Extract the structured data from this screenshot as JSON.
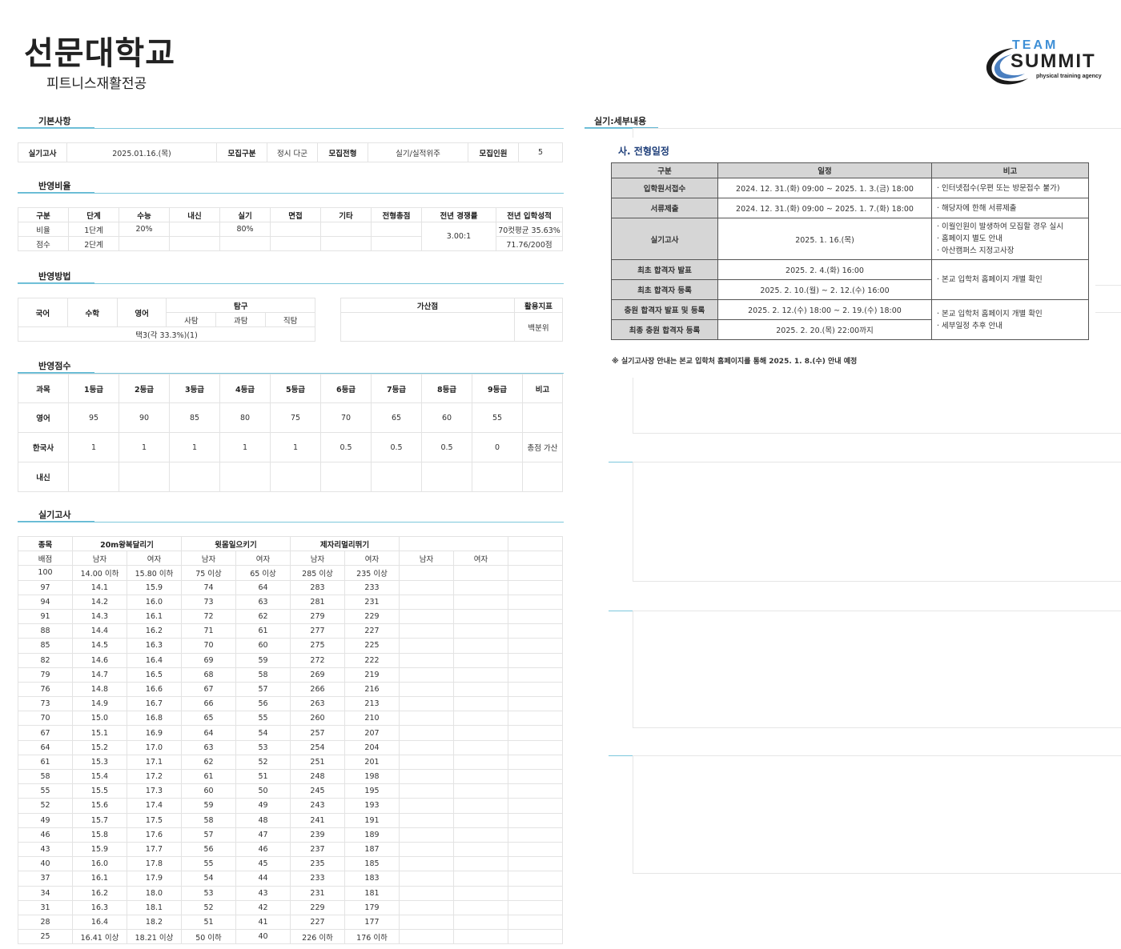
{
  "header": {
    "university": "선문대학교",
    "department": "피트니스재활전공"
  },
  "logo": {
    "line1": "TEAM",
    "line2": "SUMMIT",
    "tagline": "physical training agency",
    "icon": "swoosh-icon"
  },
  "sections": {
    "basic": "기본사항",
    "ratio": "반영비율",
    "method": "반영방법",
    "score": "반영점수",
    "practical": "실기고사",
    "detail": "실기:세부내용"
  },
  "basic": {
    "exam_label": "실기고사",
    "exam_value": "2025.01.16.(목)",
    "type_label": "모집구분",
    "type_value": "정시 다군",
    "track_label": "모집전형",
    "track_value": "실기/실적위주",
    "count_label": "모집인원",
    "count_value": "5"
  },
  "ratio": {
    "headers": [
      "구분",
      "단계",
      "수능",
      "내신",
      "실기",
      "면접",
      "기타",
      "전형총점",
      "전년 경쟁률",
      "전년 입학성적"
    ],
    "row1": [
      "비율",
      "1단계",
      "20%",
      "",
      "80%",
      "",
      "",
      ""
    ],
    "row2": [
      "점수",
      "2단계",
      "",
      "",
      "",
      "",
      "",
      ""
    ],
    "competition": "3.00:1",
    "prev1": "70컷평균 35.63%",
    "prev2": "71.76/200점"
  },
  "method": {
    "kor": "국어",
    "math": "수학",
    "eng": "영어",
    "inquiry": "탐구",
    "sub": [
      "사탐",
      "과탐",
      "직탐"
    ],
    "choice": "택3(각 33.3%)(1)",
    "bonus": "가산점",
    "index": "활용지표",
    "index_value": "백분위"
  },
  "score": {
    "headers": [
      "과목",
      "1등급",
      "2등급",
      "3등급",
      "4등급",
      "5등급",
      "6등급",
      "7등급",
      "8등급",
      "9등급",
      "비고"
    ],
    "rows": [
      [
        "영어",
        "95",
        "90",
        "85",
        "80",
        "75",
        "70",
        "65",
        "60",
        "55",
        ""
      ],
      [
        "한국사",
        "1",
        "1",
        "1",
        "1",
        "1",
        "0.5",
        "0.5",
        "0.5",
        "0",
        "총점 가산"
      ],
      [
        "내신",
        "",
        "",
        "",
        "",
        "",
        "",
        "",
        "",
        "",
        ""
      ]
    ]
  },
  "practical": {
    "col_event": "종목",
    "col_score": "배점",
    "events": [
      "20m왕복달리기",
      "윗몸일으키기",
      "제자리멀리뛰기"
    ],
    "male": "남자",
    "female": "여자",
    "rows": [
      [
        "100",
        "14.00 이하",
        "15.80 이하",
        "75 이상",
        "65 이상",
        "285 이상",
        "235 이상"
      ],
      [
        "97",
        "14.1",
        "15.9",
        "74",
        "64",
        "283",
        "233"
      ],
      [
        "94",
        "14.2",
        "16.0",
        "73",
        "63",
        "281",
        "231"
      ],
      [
        "91",
        "14.3",
        "16.1",
        "72",
        "62",
        "279",
        "229"
      ],
      [
        "88",
        "14.4",
        "16.2",
        "71",
        "61",
        "277",
        "227"
      ],
      [
        "85",
        "14.5",
        "16.3",
        "70",
        "60",
        "275",
        "225"
      ],
      [
        "82",
        "14.6",
        "16.4",
        "69",
        "59",
        "272",
        "222"
      ],
      [
        "79",
        "14.7",
        "16.5",
        "68",
        "58",
        "269",
        "219"
      ],
      [
        "76",
        "14.8",
        "16.6",
        "67",
        "57",
        "266",
        "216"
      ],
      [
        "73",
        "14.9",
        "16.7",
        "66",
        "56",
        "263",
        "213"
      ],
      [
        "70",
        "15.0",
        "16.8",
        "65",
        "55",
        "260",
        "210"
      ],
      [
        "67",
        "15.1",
        "16.9",
        "64",
        "54",
        "257",
        "207"
      ],
      [
        "64",
        "15.2",
        "17.0",
        "63",
        "53",
        "254",
        "204"
      ],
      [
        "61",
        "15.3",
        "17.1",
        "62",
        "52",
        "251",
        "201"
      ],
      [
        "58",
        "15.4",
        "17.2",
        "61",
        "51",
        "248",
        "198"
      ],
      [
        "55",
        "15.5",
        "17.3",
        "60",
        "50",
        "245",
        "195"
      ],
      [
        "52",
        "15.6",
        "17.4",
        "59",
        "49",
        "243",
        "193"
      ],
      [
        "49",
        "15.7",
        "17.5",
        "58",
        "48",
        "241",
        "191"
      ],
      [
        "46",
        "15.8",
        "17.6",
        "57",
        "47",
        "239",
        "189"
      ],
      [
        "43",
        "15.9",
        "17.7",
        "56",
        "46",
        "237",
        "187"
      ],
      [
        "40",
        "16.0",
        "17.8",
        "55",
        "45",
        "235",
        "185"
      ],
      [
        "37",
        "16.1",
        "17.9",
        "54",
        "44",
        "233",
        "183"
      ],
      [
        "34",
        "16.2",
        "18.0",
        "53",
        "43",
        "231",
        "181"
      ],
      [
        "31",
        "16.3",
        "18.1",
        "52",
        "42",
        "229",
        "179"
      ],
      [
        "28",
        "16.4",
        "18.2",
        "51",
        "41",
        "227",
        "177"
      ],
      [
        "25",
        "16.41 이상",
        "18.21 이상",
        "50 이하",
        "40",
        "226 이하",
        "176 이하"
      ]
    ]
  },
  "schedule": {
    "title": "사. 전형일정",
    "headers": [
      "구분",
      "일정",
      "비고"
    ],
    "rows": [
      {
        "label": "입학원서접수",
        "date": "2024. 12. 31.(화) 09:00 ~ 2025. 1. 3.(금) 18:00"
      },
      {
        "label": "서류제출",
        "date": "2024. 12. 31.(화) 09:00 ~ 2025. 1. 7.(화) 18:00"
      },
      {
        "label": "실기고사",
        "date": "2025. 1. 16.(목)"
      },
      {
        "label": "최초 합격자 발표",
        "date": "2025. 2. 4.(화) 16:00"
      },
      {
        "label": "최초 합격자 등록",
        "date": "2025. 2. 10.(월) ~ 2. 12.(수) 16:00"
      },
      {
        "label": "충원 합격자 발표 및 등록",
        "date": "2025. 2. 12.(수) 18:00 ~ 2. 19.(수) 18:00"
      },
      {
        "label": "최종 충원 합격자 등록",
        "date": "2025. 2. 20.(목) 22:00까지"
      }
    ],
    "notes": {
      "n1": "· 인터넷접수(우편 또는 방문접수 불가)",
      "n2": "· 해당자에 한해 서류제출",
      "n3a": "· 이월인원이 발생하여 모집할 경우 실시",
      "n3b": "· 홈페이지 별도 안내",
      "n3c": "· 아산캠퍼스 지정고사장",
      "n4": "· 본교 입학처 홈페이지 개별 확인",
      "n5a": "· 본교 입학처 홈페이지 개별 확인",
      "n5b": "· 세부일정 추후 안내"
    },
    "footnote": "※ 실기고사장 안내는 본교 입학처 홈페이지를 통해 2025. 1. 8.(수) 안내 예정"
  }
}
